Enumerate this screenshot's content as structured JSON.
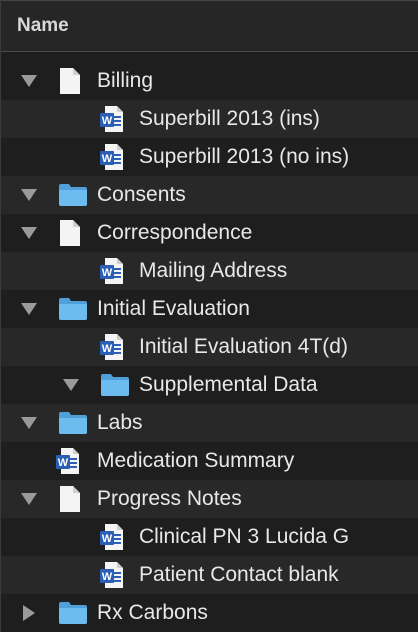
{
  "header": {
    "column_name": "Name"
  },
  "tree": [
    {
      "label": "Billing",
      "kind": "doc",
      "disclosure": "expanded",
      "level": 0
    },
    {
      "label": "Superbill 2013 (ins)",
      "kind": "word",
      "disclosure": "none",
      "level": 1
    },
    {
      "label": "Superbill 2013 (no ins)",
      "kind": "word",
      "disclosure": "none",
      "level": 1
    },
    {
      "label": "Consents",
      "kind": "folder",
      "disclosure": "expanded",
      "level": 0
    },
    {
      "label": "Correspondence",
      "kind": "doc",
      "disclosure": "expanded",
      "level": 0
    },
    {
      "label": "Mailing Address",
      "kind": "word",
      "disclosure": "none",
      "level": 1
    },
    {
      "label": "Initial Evaluation",
      "kind": "folder",
      "disclosure": "expanded",
      "level": 0
    },
    {
      "label": "Initial Evaluation 4T(d)",
      "kind": "word",
      "disclosure": "none",
      "level": 1
    },
    {
      "label": "Supplemental Data",
      "kind": "folder",
      "disclosure": "expanded",
      "level": 1
    },
    {
      "label": "Labs",
      "kind": "folder",
      "disclosure": "expanded",
      "level": 0
    },
    {
      "label": "Medication Summary",
      "kind": "word",
      "disclosure": "none",
      "level": 0
    },
    {
      "label": "Progress Notes",
      "kind": "doc",
      "disclosure": "expanded",
      "level": 0
    },
    {
      "label": "Clinical PN 3 Lucida G",
      "kind": "word",
      "disclosure": "none",
      "level": 1
    },
    {
      "label": "Patient Contact blank",
      "kind": "word",
      "disclosure": "none",
      "level": 1
    },
    {
      "label": "Rx Carbons",
      "kind": "folder",
      "disclosure": "collapsed",
      "level": 0
    }
  ],
  "colors": {
    "background": "#1e1e1e",
    "row_alt": "#282828",
    "folder": "#5ab0e8",
    "word_blue": "#2b5fb4",
    "text": "#e8e8e8"
  }
}
